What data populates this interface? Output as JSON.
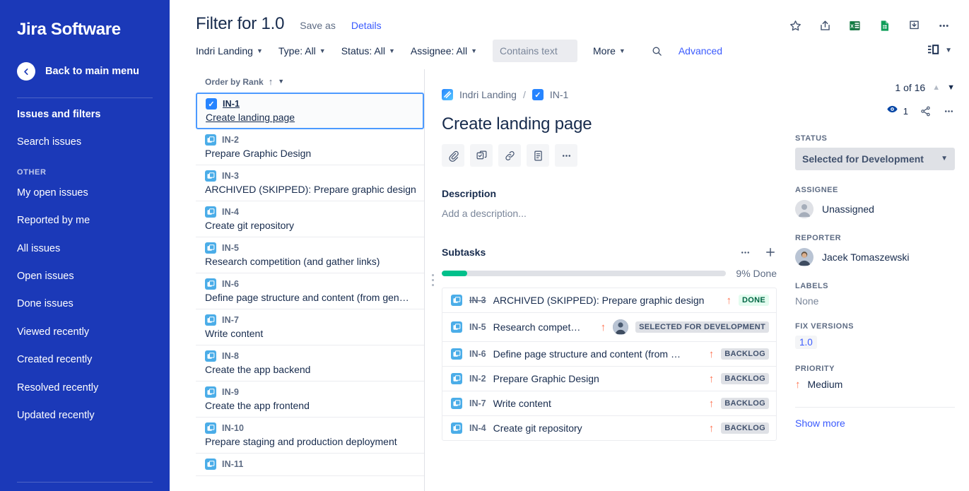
{
  "sidebar": {
    "brand": "Jira Software",
    "back_label": "Back to main menu",
    "back_icon": "arrow-left-icon",
    "primary": [
      {
        "label": "Issues and filters",
        "bold": true
      },
      {
        "label": "Search issues",
        "bold": false
      }
    ],
    "section_label": "OTHER",
    "other": [
      {
        "label": "My open issues"
      },
      {
        "label": "Reported by me"
      },
      {
        "label": "All issues"
      },
      {
        "label": "Open issues"
      },
      {
        "label": "Done issues"
      },
      {
        "label": "Viewed recently"
      },
      {
        "label": "Created recently"
      },
      {
        "label": "Resolved recently"
      },
      {
        "label": "Updated recently"
      }
    ],
    "bg_color": "#1B39B8"
  },
  "header": {
    "title": "Filter for 1.0",
    "save_as": "Save as",
    "details": "Details",
    "actions": [
      {
        "name": "star-icon"
      },
      {
        "name": "share-export-icon"
      },
      {
        "name": "excel-export-icon"
      },
      {
        "name": "google-sheets-export-icon"
      },
      {
        "name": "download-icon"
      },
      {
        "name": "more-options-icon"
      }
    ]
  },
  "filterbar": {
    "project": "Indri Landing",
    "type": "Type: All",
    "status": "Status: All",
    "assignee": "Assignee: All",
    "text_placeholder": "Contains text",
    "text_value": "",
    "more": "More",
    "search_icon": "search-icon",
    "advanced": "Advanced",
    "layout_icon": "layout-toggle-icon"
  },
  "issue_list": {
    "order_label": "Order by Rank",
    "items": [
      {
        "key": "IN-1",
        "summary": "Create landing page",
        "type": "task",
        "selected": true
      },
      {
        "key": "IN-2",
        "summary": "Prepare Graphic Design",
        "type": "subtask",
        "selected": false
      },
      {
        "key": "IN-3",
        "summary": "ARCHIVED (SKIPPED): Prepare graphic design",
        "type": "subtask",
        "selected": false
      },
      {
        "key": "IN-4",
        "summary": "Create git repository",
        "type": "subtask",
        "selected": false
      },
      {
        "key": "IN-5",
        "summary": "Research competition (and gather links)",
        "type": "subtask",
        "selected": false
      },
      {
        "key": "IN-6",
        "summary": "Define page structure and content (from gen…",
        "type": "subtask",
        "selected": false
      },
      {
        "key": "IN-7",
        "summary": "Write content",
        "type": "subtask",
        "selected": false
      },
      {
        "key": "IN-8",
        "summary": "Create the app backend",
        "type": "subtask",
        "selected": false
      },
      {
        "key": "IN-9",
        "summary": "Create the app frontend",
        "type": "subtask",
        "selected": false
      },
      {
        "key": "IN-10",
        "summary": "Prepare staging and production deployment",
        "type": "subtask",
        "selected": false
      },
      {
        "key": "IN-11",
        "summary": "",
        "type": "subtask",
        "selected": false
      }
    ]
  },
  "detail": {
    "breadcrumb_project": "Indri Landing",
    "breadcrumb_sep": "/",
    "breadcrumb_key": "IN-1",
    "title": "Create landing page",
    "action_buttons": [
      {
        "name": "attach-icon"
      },
      {
        "name": "create-subtask-icon"
      },
      {
        "name": "link-issue-icon"
      },
      {
        "name": "add-note-icon"
      },
      {
        "name": "more-actions-icon"
      }
    ],
    "description_heading": "Description",
    "description_placeholder": "Add a description...",
    "subtasks_heading": "Subtasks",
    "progress_percent": 9,
    "progress_label": "9% Done",
    "subtasks": [
      {
        "key": "IN-3",
        "summary": "ARCHIVED (SKIPPED): Prepare graphic design",
        "status": "DONE",
        "status_style": "done",
        "priority": "Medium",
        "struck": true,
        "has_avatar": false
      },
      {
        "key": "IN-5",
        "summary": "Research compet…",
        "status": "SELECTED FOR DEVELOPMENT",
        "status_style": "grey",
        "priority": "Medium",
        "struck": false,
        "has_avatar": true
      },
      {
        "key": "IN-6",
        "summary": "Define page structure and content (from …",
        "status": "BACKLOG",
        "status_style": "grey",
        "priority": "Medium",
        "struck": false,
        "has_avatar": false
      },
      {
        "key": "IN-2",
        "summary": "Prepare Graphic Design",
        "status": "BACKLOG",
        "status_style": "grey",
        "priority": "Medium",
        "struck": false,
        "has_avatar": false
      },
      {
        "key": "IN-7",
        "summary": "Write content",
        "status": "BACKLOG",
        "status_style": "grey",
        "priority": "Medium",
        "struck": false,
        "has_avatar": false
      },
      {
        "key": "IN-4",
        "summary": "Create git repository",
        "status": "BACKLOG",
        "status_style": "grey",
        "priority": "Medium",
        "struck": false,
        "has_avatar": false
      }
    ]
  },
  "right_panel": {
    "nav_count": "1 of 16",
    "watch_count": "1",
    "watch_icon": "watch-eye-icon",
    "share_icon": "share-icon",
    "more_icon": "more-options-icon",
    "status_label": "STATUS",
    "status_value": "Selected for Development",
    "assignee_label": "ASSIGNEE",
    "assignee_value": "Unassigned",
    "reporter_label": "REPORTER",
    "reporter_value": "Jacek Tomaszewski",
    "labels_label": "LABELS",
    "labels_value": "None",
    "fix_versions_label": "FIX VERSIONS",
    "fix_versions_value": "1.0",
    "priority_label": "PRIORITY",
    "priority_value": "Medium",
    "show_more": "Show more"
  },
  "colors": {
    "sidebar_blue": "#1B39B8",
    "link_blue": "#3B5BFE",
    "priority_orange": "#FF7452",
    "progress_green": "#00C08B",
    "done_badge_bg": "#E3FCEF"
  }
}
